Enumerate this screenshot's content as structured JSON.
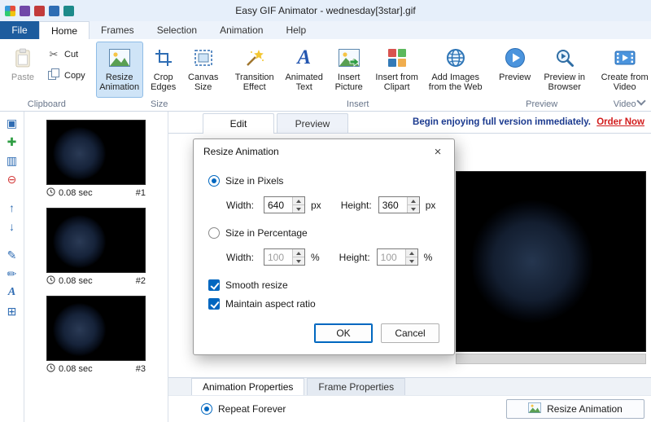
{
  "window": {
    "title": "Easy GIF Animator - wednesday[3star].gif"
  },
  "menu": {
    "file": "File",
    "tabs": [
      {
        "label": "Home"
      },
      {
        "label": "Frames"
      },
      {
        "label": "Selection"
      },
      {
        "label": "Animation"
      },
      {
        "label": "Help"
      }
    ]
  },
  "ribbon": {
    "clipboard": {
      "label": "Clipboard",
      "paste": "Paste",
      "cut": "Cut",
      "copy": "Copy"
    },
    "size": {
      "label": "Size",
      "resize": "Resize Animation",
      "crop": "Crop Edges",
      "canvas": "Canvas Size"
    },
    "insert": {
      "label": "Insert",
      "transition": "Transition Effect",
      "text": "Animated Text",
      "picture": "Insert Picture",
      "clipart": "Insert from Clipart",
      "web": "Add Images from the Web"
    },
    "preview": {
      "label": "Preview",
      "preview": "Preview",
      "browser": "Preview in Browser"
    },
    "video": {
      "label": "Video",
      "create": "Create from Video"
    }
  },
  "frames": [
    {
      "duration": "0.08 sec",
      "number": "#1"
    },
    {
      "duration": "0.08 sec",
      "number": "#2"
    },
    {
      "duration": "0.08 sec",
      "number": "#3"
    }
  ],
  "workspace": {
    "edit_tab": "Edit",
    "preview_tab": "Preview",
    "promo_text": "Begin enjoying full version immediately.",
    "promo_link": "Order Now"
  },
  "dialog": {
    "title": "Resize Animation",
    "close": "×",
    "size_pixels": "Size in Pixels",
    "size_percentage": "Size in Percentage",
    "width_label": "Width:",
    "height_label": "Height:",
    "width_px": "640",
    "height_px": "360",
    "width_pct": "100",
    "height_pct": "100",
    "unit_px": "px",
    "unit_pct": "%",
    "smooth": "Smooth resize",
    "aspect": "Maintain aspect ratio",
    "ok": "OK",
    "cancel": "Cancel"
  },
  "properties": {
    "animation_tab": "Animation Properties",
    "frame_tab": "Frame Properties",
    "repeat": "Repeat Forever",
    "resize_button": "Resize Animation"
  },
  "strip_icons": [
    {
      "glyph": "▣"
    },
    {
      "glyph": "✚"
    },
    {
      "glyph": "▥"
    },
    {
      "glyph": "⊖"
    },
    {
      "glyph": "↑"
    },
    {
      "glyph": "↓"
    },
    {
      "glyph": "✎"
    },
    {
      "glyph": "✏"
    },
    {
      "glyph": "A"
    },
    {
      "glyph": "⊞"
    }
  ],
  "glyphs": {
    "cut": "✂"
  },
  "colors": {
    "accent": "#0067c0",
    "ribbon_selection": "#cfe4f7",
    "file_button": "#1d5c9e",
    "promo_link": "#d21c1c",
    "titlebar": "#e6effa"
  }
}
